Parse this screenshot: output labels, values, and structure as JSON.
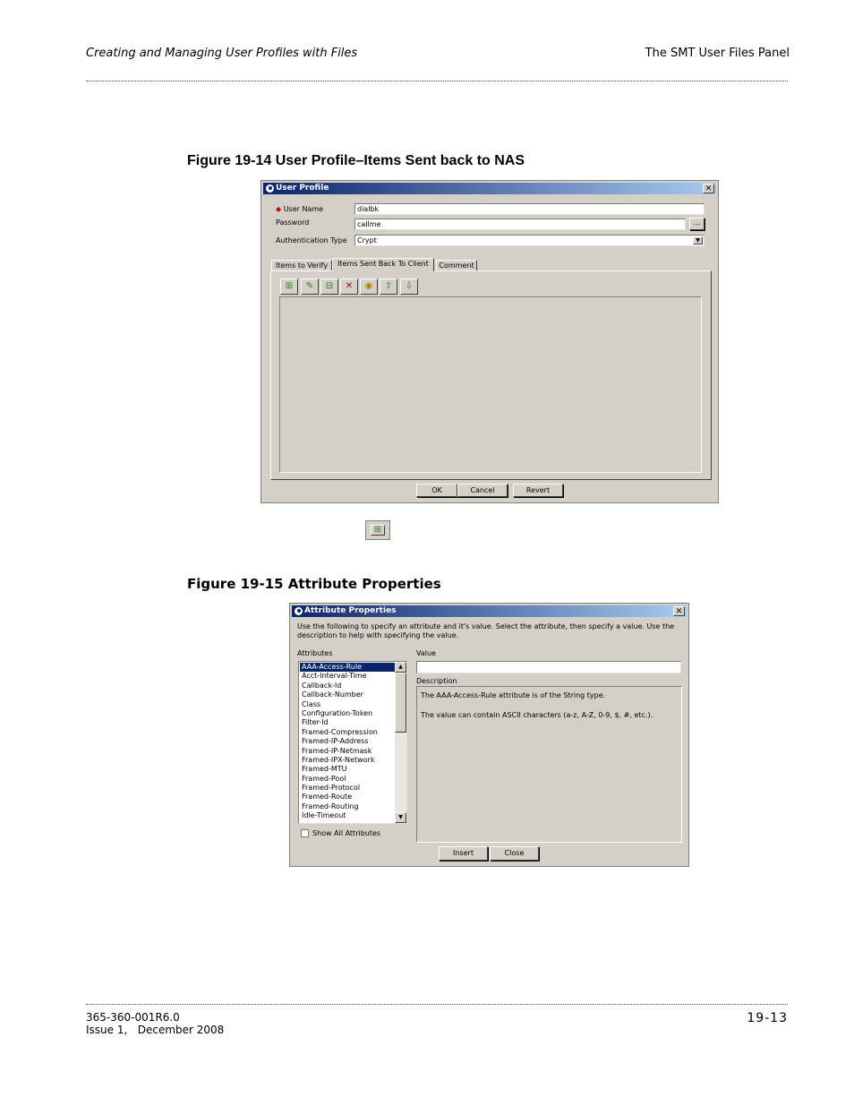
{
  "header": {
    "left": "Creating and Managing User Profiles with Files",
    "right": "The SMT User Files Panel"
  },
  "figure1": {
    "caption": "Figure 19-14  User Profile–Items Sent back to NAS",
    "dialog": {
      "title": "User Profile",
      "close": "✕",
      "user_name_label": "User Name",
      "user_name_value": "dialbk",
      "password_label": "Password",
      "password_value": "callme",
      "password_btn": "...",
      "auth_label": "Authentication Type",
      "auth_value": "Crypt",
      "tabs": [
        "Items to Verify",
        "Items Sent Back To Client",
        "Comment"
      ],
      "selected_tab": "Items Sent Back To Client",
      "toolbar_icons": [
        "add-icon",
        "edit-icon",
        "remove-icon",
        "delete-icon",
        "properties-icon",
        "move-up-icon",
        "move-down-icon"
      ],
      "buttons": {
        "ok": "OK",
        "cancel": "Cancel",
        "revert": "Revert"
      }
    }
  },
  "inline_icon": "add-icon",
  "figure2": {
    "caption": "Figure 19-15   Attribute Properties",
    "dialog": {
      "title": "Attribute Properties",
      "close": "✕",
      "intro": "Use the following to specify an attribute and it's value. Select the attribute, then specify a value. Use the description to help with specifying the value.",
      "attributes_label": "Attributes",
      "value_label": "Value",
      "description_label": "Description",
      "attributes": [
        "AAA-Access-Rule",
        "Acct-Interval-Time",
        "Callback-Id",
        "Callback-Number",
        "Class",
        "Configuration-Token",
        "Filter-Id",
        "Framed-Compression",
        "Framed-IP-Address",
        "Framed-IP-Netmask",
        "Framed-IPX-Network",
        "Framed-MTU",
        "Framed-Pool",
        "Framed-Protocol",
        "Framed-Route",
        "Framed-Routing",
        "Idle-Timeout"
      ],
      "selected_attribute": "AAA-Access-Rule",
      "description_line1": "The AAA-Access-Rule attribute is of the String type.",
      "description_line2": "The value can contain ASCII characters (a-z, A-Z, 0-9, $, #, etc.).",
      "show_all_label": "Show All Attributes",
      "buttons": {
        "insert": "Insert",
        "close": "Close"
      }
    }
  },
  "footer": {
    "doc_id": "365-360-001R6.0",
    "issue": "Issue 1,   December 2008",
    "page": "19-13"
  }
}
